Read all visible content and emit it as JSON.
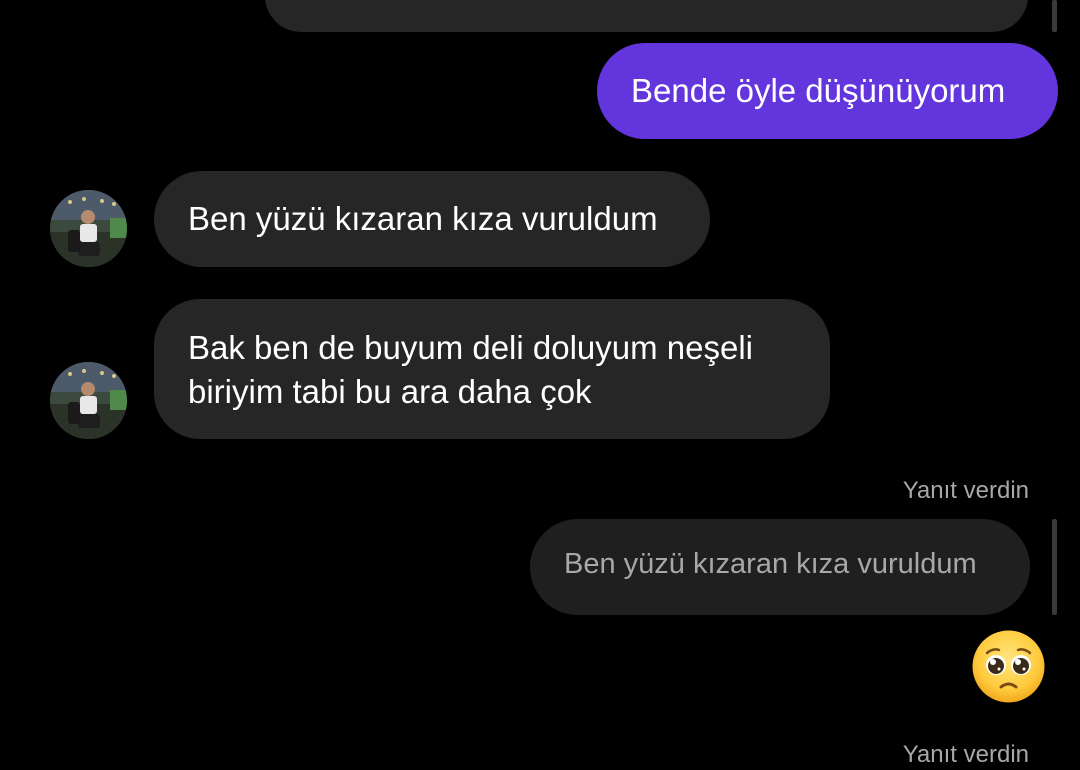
{
  "conversation": {
    "messages": [
      {
        "id": "top-cut",
        "direction": "sent",
        "text": ""
      },
      {
        "id": "m1",
        "direction": "sent",
        "text": "Bende öyle düşünüyorum"
      },
      {
        "id": "m2",
        "direction": "received",
        "text": "Ben yüzü kızaran kıza vuruldum"
      },
      {
        "id": "m3",
        "direction": "received",
        "text_lines": [
          "Bak ben de buyum deli doluyum neşeli",
          "biriyim tabi bu ara daha çok"
        ]
      }
    ],
    "reply_1": {
      "label": "Yanıt verdin",
      "quoted_text": "Ben yüzü kızaran kıza vuruldum"
    },
    "reply_2": {
      "label": "Yanıt verdin"
    },
    "reaction_emoji": "pleading-face",
    "colors": {
      "background": "#000000",
      "sent_bubble": "#6236dc",
      "received_bubble": "#262626",
      "quoted_bubble": "#1f1f1f",
      "secondary_text": "#a8a8a8"
    }
  }
}
